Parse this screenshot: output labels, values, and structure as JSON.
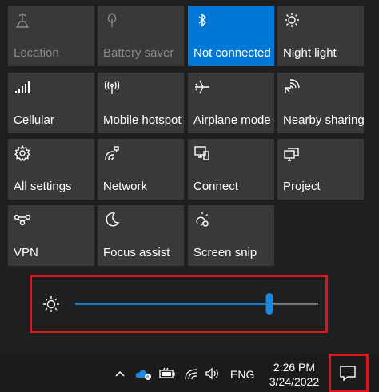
{
  "tiles": [
    {
      "label": "Location",
      "icon": "location-icon",
      "state": "disabled"
    },
    {
      "label": "Battery saver",
      "icon": "battery-saver-icon",
      "state": "disabled"
    },
    {
      "label": "Not connected",
      "icon": "bluetooth-icon",
      "state": "active"
    },
    {
      "label": "Night light",
      "icon": "night-light-icon",
      "state": "normal"
    },
    {
      "label": "Cellular",
      "icon": "cellular-icon",
      "state": "normal"
    },
    {
      "label": "Mobile hotspot",
      "icon": "mobile-hotspot-icon",
      "state": "normal"
    },
    {
      "label": "Airplane mode",
      "icon": "airplane-icon",
      "state": "normal"
    },
    {
      "label": "Nearby sharing",
      "icon": "nearby-sharing-icon",
      "state": "normal"
    },
    {
      "label": "All settings",
      "icon": "gear-icon",
      "state": "normal"
    },
    {
      "label": "Network",
      "icon": "network-icon",
      "state": "normal"
    },
    {
      "label": "Connect",
      "icon": "connect-icon",
      "state": "normal"
    },
    {
      "label": "Project",
      "icon": "project-icon",
      "state": "normal"
    },
    {
      "label": "VPN",
      "icon": "vpn-icon",
      "state": "normal"
    },
    {
      "label": "Focus assist",
      "icon": "moon-icon",
      "state": "normal"
    },
    {
      "label": "Screen snip",
      "icon": "screen-snip-icon",
      "state": "normal"
    }
  ],
  "brightness": {
    "icon": "brightness-icon",
    "level_percent": 80
  },
  "taskbar": {
    "icons": [
      "chevron-up-icon",
      "onedrive-icon",
      "battery-icon",
      "wifi-icon",
      "volume-icon"
    ],
    "language": "ENG",
    "time": "2:26 PM",
    "date": "3/24/2022",
    "notification_icon": "action-center-icon"
  },
  "colors": {
    "accent": "#0078d7",
    "tile": "#393939",
    "background": "#1f1f1f",
    "highlight": "#e0141e"
  }
}
